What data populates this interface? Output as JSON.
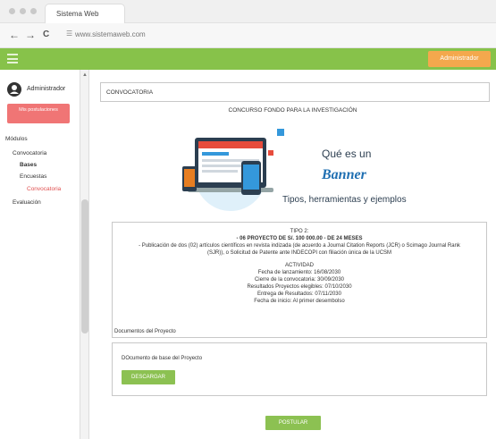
{
  "browser": {
    "tab_title": "Sistema Web",
    "back": "←",
    "forward": "→",
    "reload": "C",
    "url": "www.sistemaweb.com"
  },
  "header": {
    "admin_label": "Administrador"
  },
  "sidebar": {
    "user_name": "Administrador",
    "role_badge": "Mis postulaciones",
    "modules_label": "Módulos",
    "items": [
      {
        "label": "Convocatoria"
      },
      {
        "label": "Bases"
      },
      {
        "label": "Encuestas"
      },
      {
        "label": "Convocatoria"
      },
      {
        "label": "Evaluación"
      }
    ]
  },
  "main": {
    "section_title": "CONVOCATORIA",
    "contest_title": "CONCURSO FONDO PARA LA INVESTIGACIÓN",
    "banner": {
      "line1": "Qué es un",
      "line2": "Banner",
      "line3": "Tipos, herramientas y ejemplos"
    },
    "info": {
      "type_title": "TIPO 2:",
      "project_line": "- 06 PROYECTO DE S/. 100 000.00 - DE 24 MESES",
      "publication_line1": "- Publicación de dos (02) artículos científicos en revista indizada (de acuerdo a Journal Citation Reports (JCR) o Scimago Journal Rank",
      "publication_line2": "(SJR)), o Solicitud de Patente ante INDECOPI con filiación única de la UCSM",
      "activity_title": "ACTIVIDAD",
      "launch_date": "Fecha de lanzamiento: 16/08/2030",
      "close_date": "Cierre de la convocatoria: 30/09/2030",
      "eligible_results": "Resultados Proyectos elegibles: 07/10/2030",
      "results_delivery": "Entrega de Resultados: 07/11/2030",
      "start_date": "Fecha de inicio: Al primer desembolso"
    },
    "docs_label": "Documentos del Proyecto",
    "doc_name": "DOcumento de base del Proyecto",
    "download_label": "DESCARGAR",
    "apply_label": "POSTULAR"
  }
}
